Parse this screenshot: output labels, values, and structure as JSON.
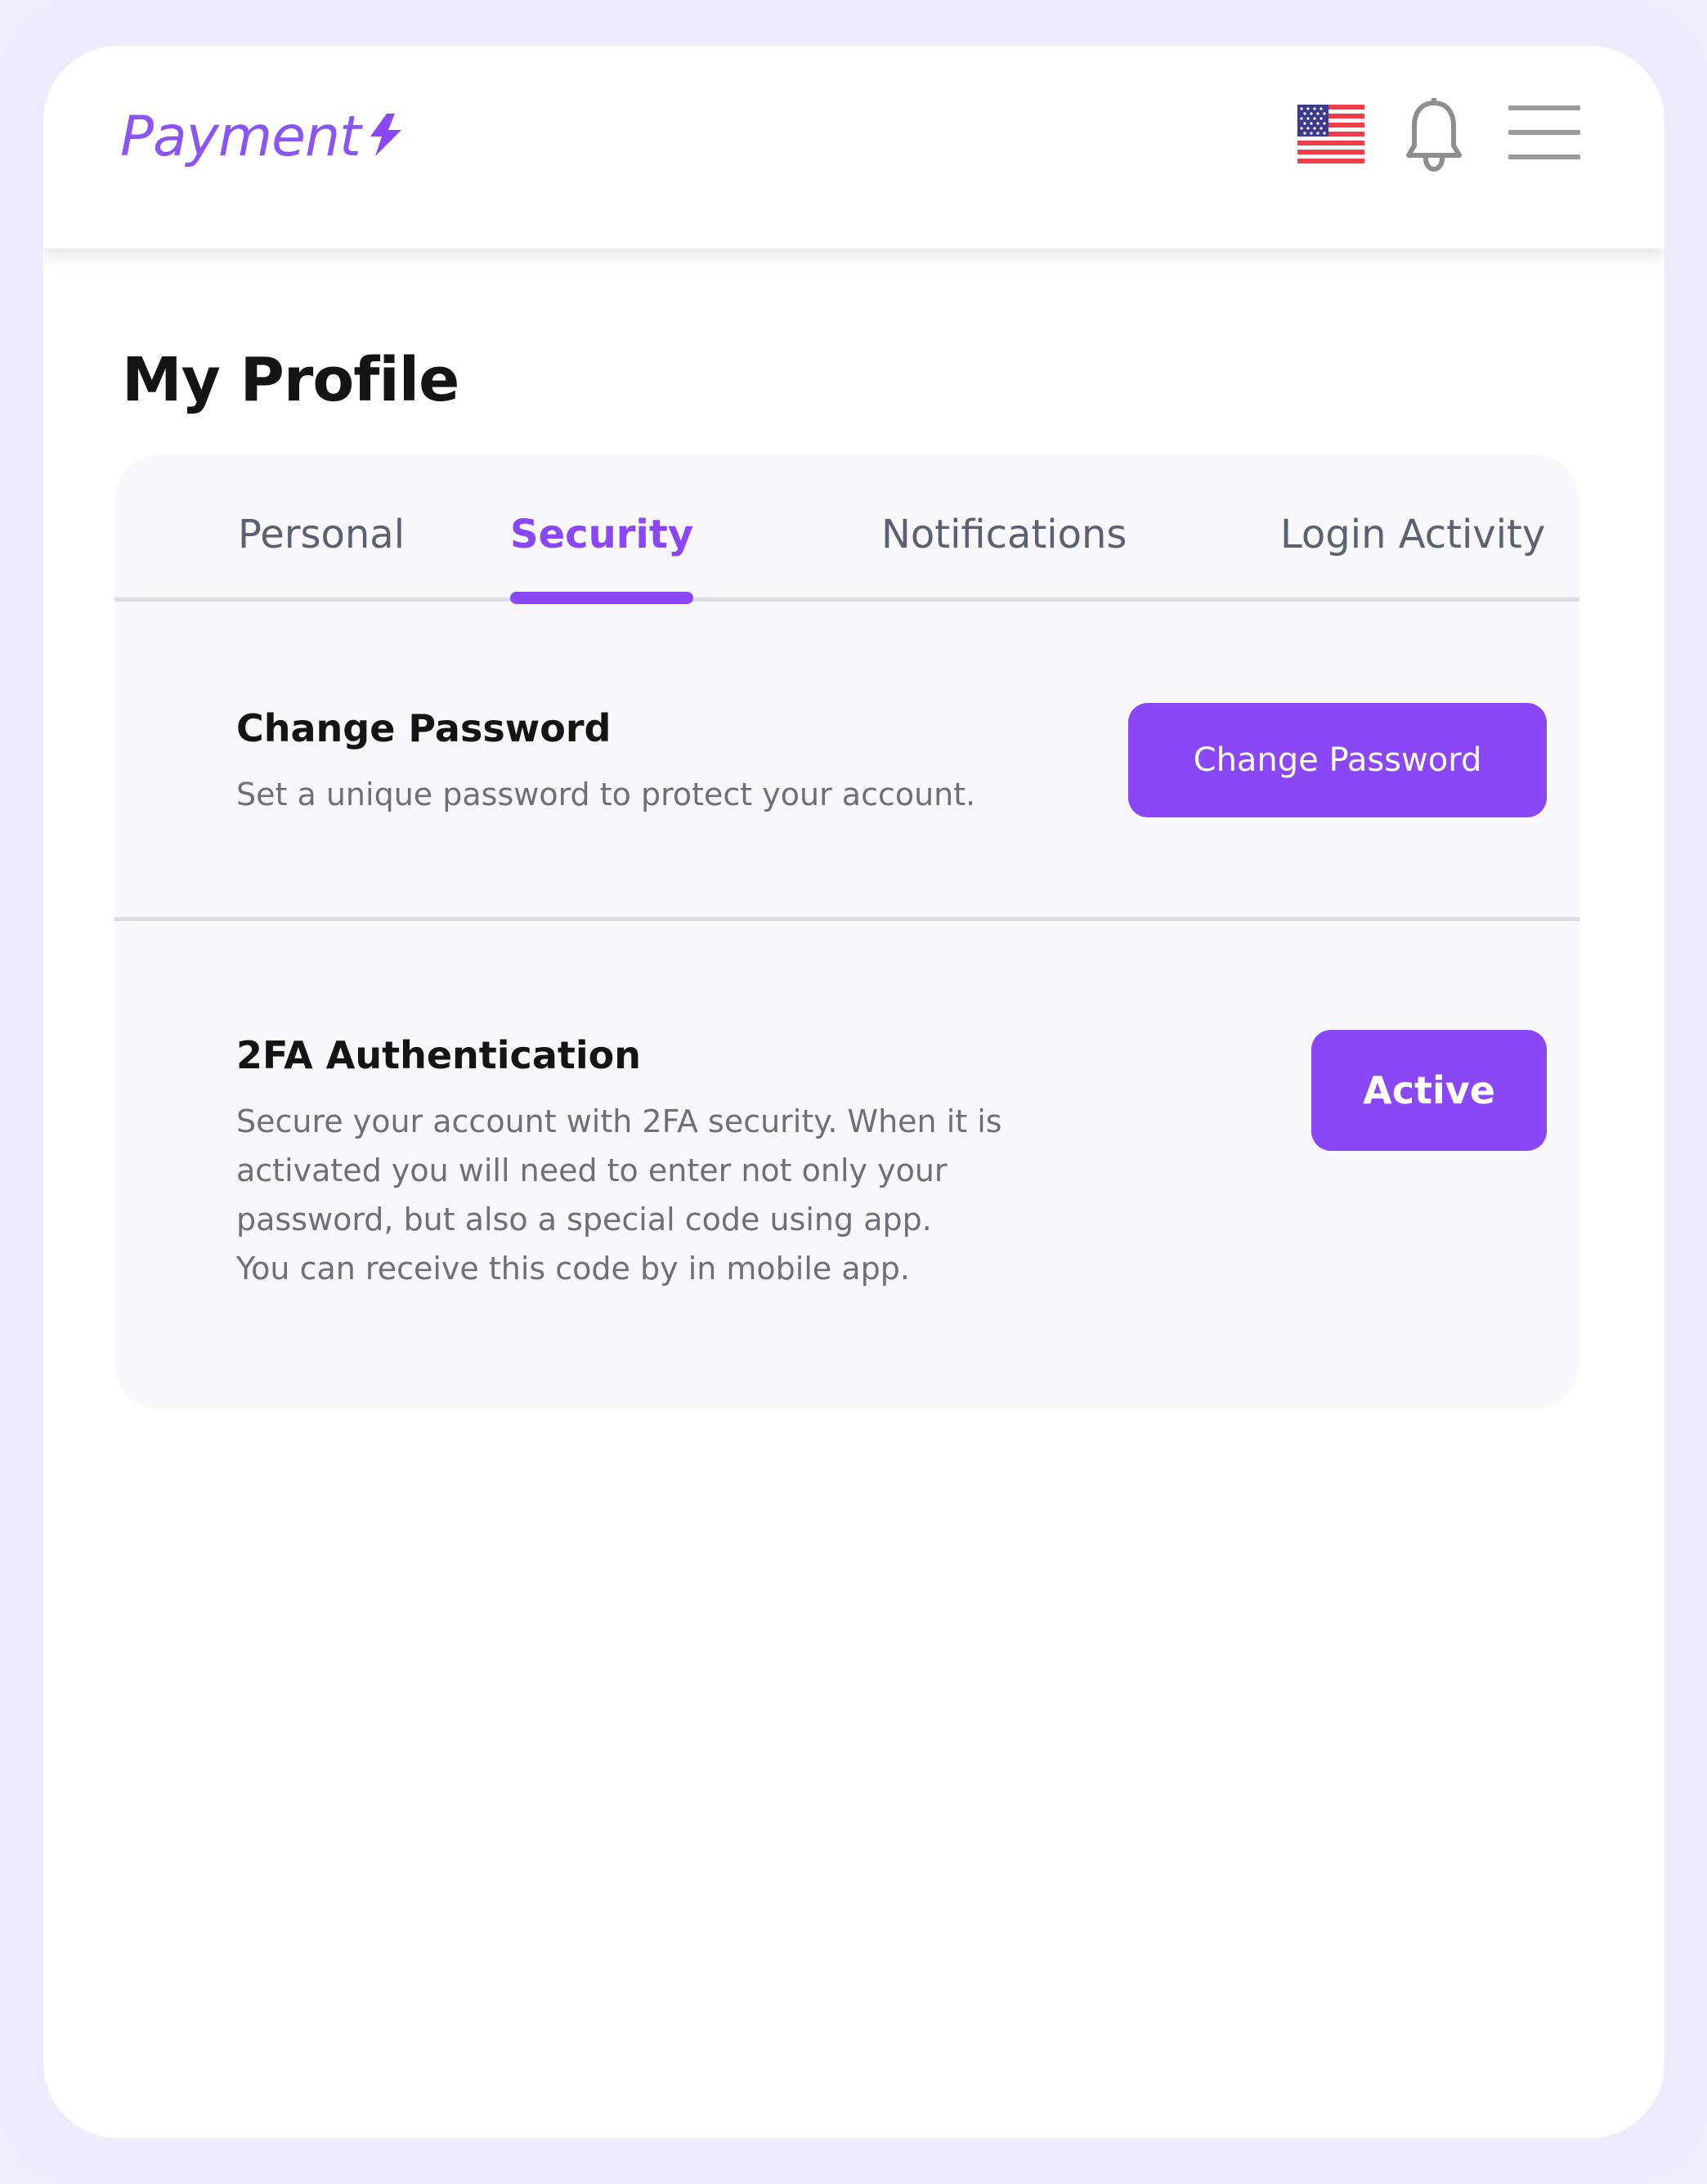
{
  "header": {
    "logo_text": "Payment",
    "flag_icon": "us-flag-icon",
    "bell_icon": "bell-icon",
    "menu_icon": "hamburger-menu-icon"
  },
  "page": {
    "title": "My Profile"
  },
  "tabs": [
    {
      "label": "Personal",
      "active": false
    },
    {
      "label": "Security",
      "active": true
    },
    {
      "label": "Notifications",
      "active": false
    },
    {
      "label": "Login Activity",
      "active": false
    }
  ],
  "change_password": {
    "title": "Change Password",
    "description": "Set a unique password to protect your account.",
    "button_label": "Change Password"
  },
  "two_fa": {
    "title": "2FA Authentication",
    "description_lines": [
      "Secure your account with 2FA security. When it is",
      "activated you will need to enter not only your",
      "password, but also a special code using app.",
      "You can receive this code by in mobile app."
    ],
    "button_label": "Active"
  },
  "colors": {
    "accent": "#8a47f5",
    "background": "#efeafc",
    "card": "#f7f7fc",
    "text_primary": "#141414",
    "text_secondary": "#6f6f78"
  }
}
